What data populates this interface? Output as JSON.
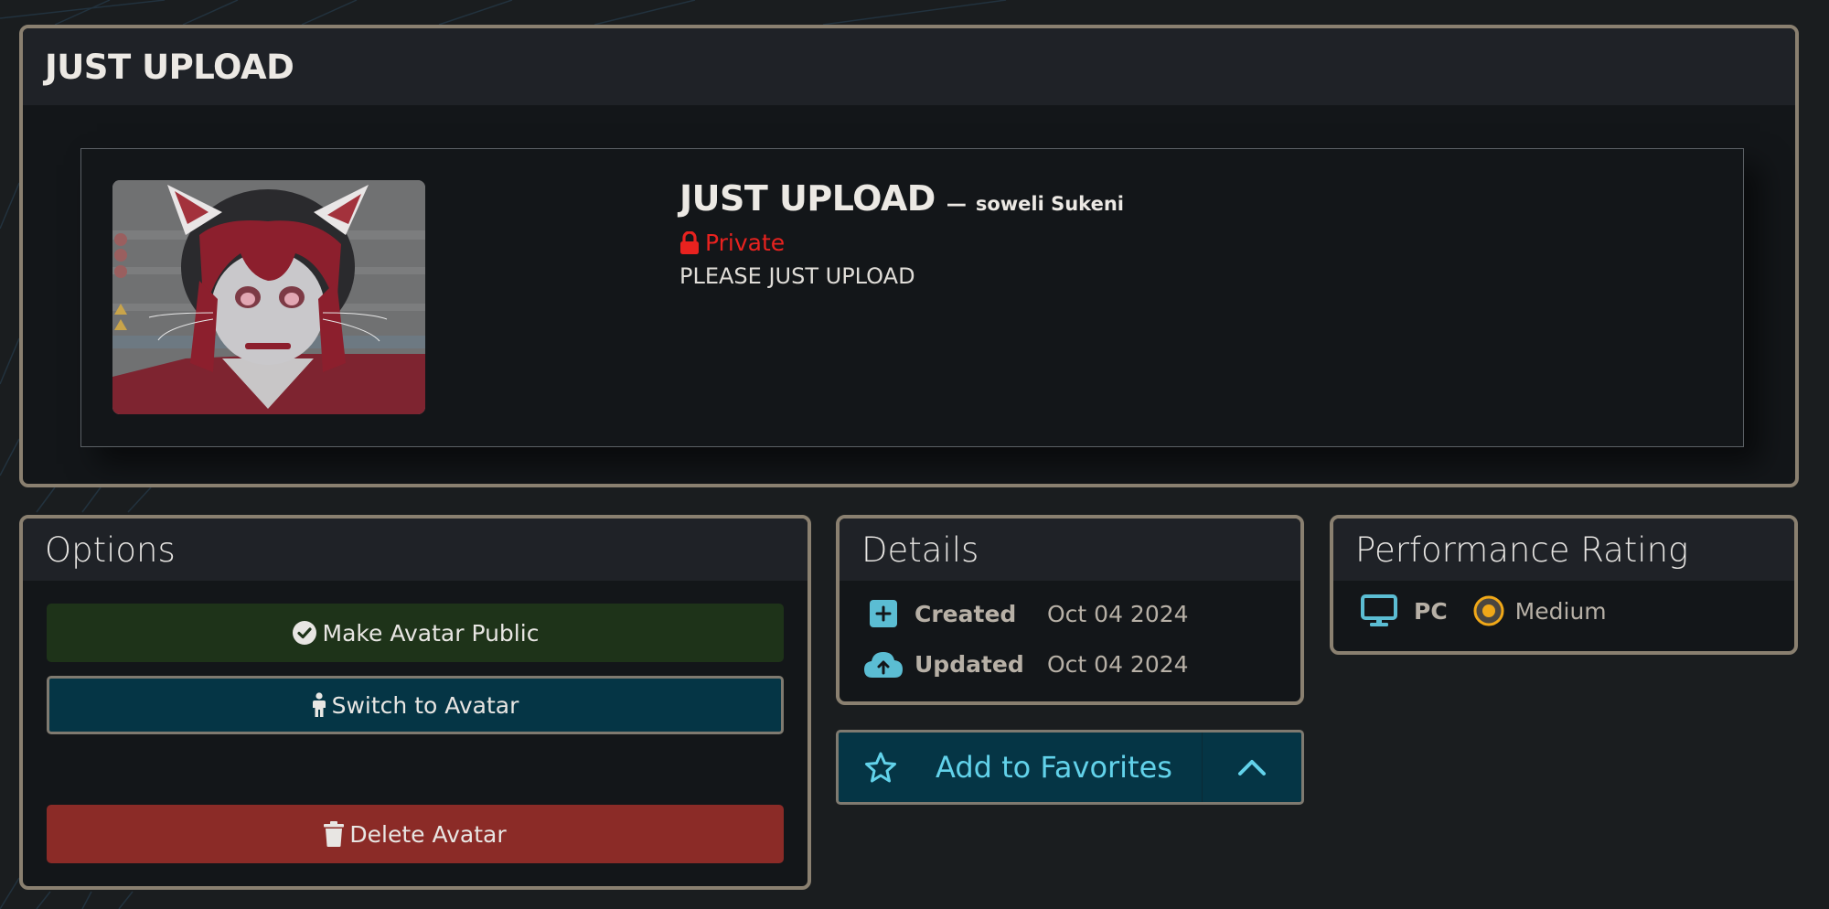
{
  "main": {
    "title": "JUST UPLOAD",
    "avatar": {
      "name": "JUST UPLOAD",
      "separator": "—",
      "author": "soweli Sukeni",
      "privacy": "Private",
      "description": "PLEASE JUST UPLOAD",
      "thumbnail_icon": "avatar-thumbnail"
    }
  },
  "options": {
    "title": "Options",
    "make_public_label": "Make Avatar Public",
    "switch_label": "Switch to Avatar",
    "delete_label": "Delete Avatar"
  },
  "details": {
    "title": "Details",
    "rows": [
      {
        "icon": "plus-square-icon",
        "label": "Created",
        "value": "Oct 04 2024"
      },
      {
        "icon": "cloud-upload-icon",
        "label": "Updated",
        "value": "Oct 04 2024"
      }
    ]
  },
  "favorites": {
    "label": "Add to Favorites",
    "icon": "star-icon",
    "toggle_icon": "chevron-up-icon"
  },
  "performance": {
    "title": "Performance Rating",
    "platform": "PC",
    "rating": "Medium"
  },
  "colors": {
    "panel_border": "#8a8070",
    "private_red": "#e8221f",
    "accent_cyan": "#62d2ea",
    "public_green": "#1e3319",
    "switch_teal": "#053545",
    "delete_red": "#8b2b27",
    "rating_medium": "#f0a818"
  }
}
